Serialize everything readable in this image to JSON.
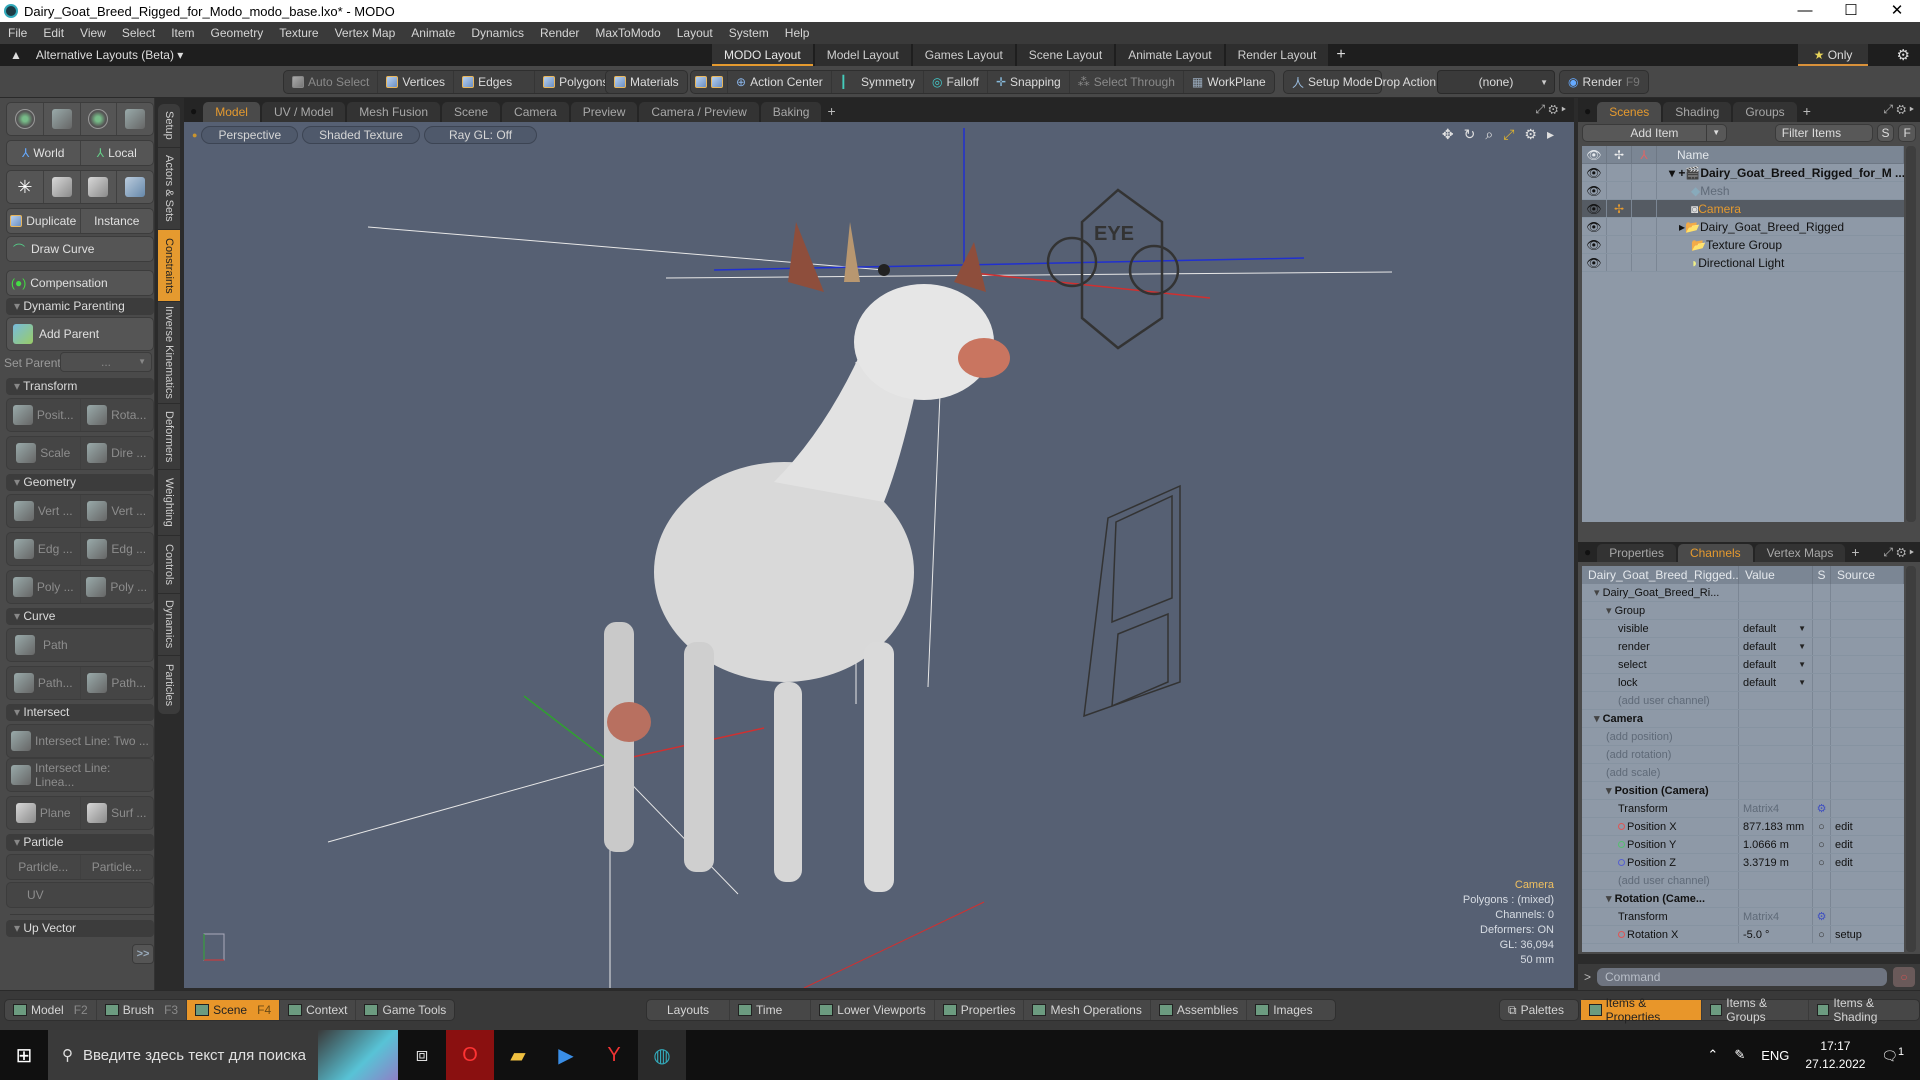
{
  "window": {
    "title": "Dairy_Goat_Breed_Rigged_for_Modo_modo_base.lxo* - MODO",
    "controls": [
      "—",
      "☐",
      "✕"
    ]
  },
  "menu": [
    "File",
    "Edit",
    "View",
    "Select",
    "Item",
    "Geometry",
    "Texture",
    "Vertex Map",
    "Animate",
    "Dynamics",
    "Render",
    "MaxToModo",
    "Layout",
    "System",
    "Help"
  ],
  "layout_row": {
    "alternative_layouts": "Alternative Layouts (Beta) ▾",
    "tabs": [
      "MODO Layout",
      "Model Layout",
      "Games Layout",
      "Scene Layout",
      "Animate Layout",
      "Render Layout"
    ],
    "active_tab": "MODO Layout",
    "plus": "+",
    "only_label": "Only"
  },
  "toolbar": {
    "auto_select": "Auto Select",
    "vertices": "Vertices",
    "edges": "Edges",
    "polygons": "Polygons",
    "materials": "Materials",
    "action_center": "Action Center",
    "symmetry": "Symmetry",
    "falloff": "Falloff",
    "snapping": "Snapping",
    "select_through": "Select Through",
    "workplane": "WorkPlane",
    "setup_mode": "Setup Mode",
    "drop_action": "Drop Action",
    "drop_action_value": "(none)",
    "render": "Render",
    "render_key": "F9"
  },
  "left_panel": {
    "world": "World",
    "local": "Local",
    "duplicate": "Duplicate",
    "instance": "Instance",
    "draw_curve": "Draw Curve",
    "compensation": "Compensation",
    "dynamic_parenting": "Dynamic Parenting",
    "add_parent": "Add Parent",
    "set_parent": "Set Parent",
    "set_parent_value": "...",
    "transform": "Transform",
    "transform_buttons": [
      "Posit...",
      "Rota...",
      "Scale",
      "Dire ..."
    ],
    "geometry": "Geometry",
    "geometry_buttons": [
      "Vert ...",
      "Vert ...",
      "Edg ...",
      "Edg ...",
      "Poly ...",
      "Poly ..."
    ],
    "curve": "Curve",
    "path": "Path",
    "path_buttons": [
      "Path...",
      "Path..."
    ],
    "intersect": "Intersect",
    "intersect_buttons": [
      "Intersect Line: Two ...",
      "Intersect Line: Linea..."
    ],
    "plane_buttons": [
      "Plane",
      "Surf ..."
    ],
    "particle": "Particle",
    "particle_buttons": [
      "Particle...",
      "Particle..."
    ],
    "uv": "UV",
    "up_vector": "Up Vector",
    "more": ">>"
  },
  "vertical_tabs": [
    "Setup",
    "Actors & Sets",
    "Constraints",
    "Inverse Kinematics",
    "Deformers",
    "Weighting",
    "Controls",
    "Dynamics",
    "Particles"
  ],
  "active_vertical_tab": "Constraints",
  "viewport": {
    "tabs": [
      "Model",
      "UV / Model",
      "Mesh Fusion",
      "Scene",
      "Camera",
      "Preview",
      "Camera / Preview",
      "Baking"
    ],
    "active_tab": "Model",
    "view_mode": "Perspective",
    "shading": "Shaded Texture",
    "raygl": "Ray GL: Off",
    "gizmo_label": "EYE",
    "hud": {
      "item": "Camera",
      "polygons": "Polygons : (mixed)",
      "channels": "Channels: 0",
      "deformers": "Deformers: ON",
      "gl": "GL: 36,094",
      "focal": "50 mm"
    }
  },
  "scenes_panel": {
    "tabs": [
      "Scenes",
      "Shading",
      "Groups"
    ],
    "active_tab": "Scenes",
    "add_item": "Add Item",
    "filter_placeholder": "Filter Items",
    "s_btn": "S",
    "f_btn": "F",
    "column_name": "Name",
    "items": [
      {
        "name": "Dairy_Goat_Breed_Rigged_for_M ...",
        "level": 0,
        "type": "scene",
        "selected": false
      },
      {
        "name": "Mesh",
        "level": 1,
        "type": "mesh",
        "selected": false,
        "dim": true
      },
      {
        "name": "Camera",
        "level": 1,
        "type": "camera",
        "selected": true
      },
      {
        "name": "Dairy_Goat_Breed_Rigged",
        "level": 1,
        "type": "group",
        "selected": false
      },
      {
        "name": "Texture Group",
        "level": 1,
        "type": "group",
        "selected": false
      },
      {
        "name": "Directional Light",
        "level": 1,
        "type": "light",
        "selected": false
      }
    ]
  },
  "channels_panel": {
    "tabs": [
      "Properties",
      "Channels",
      "Vertex Maps"
    ],
    "active_tab": "Channels",
    "columns": [
      "Dairy_Goat_Breed_Rigged...",
      "Value",
      "S",
      "Source"
    ],
    "rows": [
      {
        "name": "Dairy_Goat_Breed_Ri...",
        "value": "",
        "s": "",
        "source": "",
        "indent": 1,
        "style": "item"
      },
      {
        "name": "Group",
        "value": "",
        "s": "",
        "source": "",
        "indent": 2,
        "style": "item"
      },
      {
        "name": "visible",
        "value": "default",
        "s": "",
        "source": "",
        "indent": 3,
        "dropdown": true
      },
      {
        "name": "render",
        "value": "default",
        "s": "",
        "source": "",
        "indent": 3,
        "dropdown": true
      },
      {
        "name": "select",
        "value": "default",
        "s": "",
        "source": "",
        "indent": 3,
        "dropdown": true
      },
      {
        "name": "lock",
        "value": "default",
        "s": "",
        "source": "",
        "indent": 3,
        "dropdown": true
      },
      {
        "name": "(add user channel)",
        "value": "",
        "s": "",
        "source": "",
        "indent": 3,
        "style": "ghost"
      },
      {
        "name": "Camera",
        "value": "",
        "s": "",
        "source": "",
        "indent": 1,
        "style": "bold"
      },
      {
        "name": "(add position)",
        "value": "",
        "s": "",
        "source": "",
        "indent": 2,
        "style": "ghost"
      },
      {
        "name": "(add rotation)",
        "value": "",
        "s": "",
        "source": "",
        "indent": 2,
        "style": "ghost"
      },
      {
        "name": "(add scale)",
        "value": "",
        "s": "",
        "source": "",
        "indent": 2,
        "style": "ghost"
      },
      {
        "name": "Position (Camera)",
        "value": "",
        "s": "",
        "source": "",
        "indent": 2,
        "style": "bold"
      },
      {
        "name": "Transform",
        "value": "Matrix4",
        "s": "⚙",
        "source": "",
        "indent": 3,
        "valstyle": "ghost"
      },
      {
        "name": "Position X",
        "value": "877.183 mm",
        "s": "○",
        "source": "edit",
        "indent": 3,
        "dot": "#e05555"
      },
      {
        "name": "Position Y",
        "value": "1.0666 m",
        "s": "○",
        "source": "edit",
        "indent": 3,
        "dot": "#55c070"
      },
      {
        "name": "Position Z",
        "value": "3.3719 m",
        "s": "○",
        "source": "edit",
        "indent": 3,
        "dot": "#5560d0"
      },
      {
        "name": "(add user channel)",
        "value": "",
        "s": "",
        "source": "",
        "indent": 3,
        "style": "ghost"
      },
      {
        "name": "Rotation (Came...",
        "value": "",
        "s": "",
        "source": "",
        "indent": 2,
        "style": "bold"
      },
      {
        "name": "Transform",
        "value": "Matrix4",
        "s": "⚙",
        "source": "",
        "indent": 3,
        "valstyle": "ghost"
      },
      {
        "name": "Rotation X",
        "value": "-5.0 °",
        "s": "○",
        "source": "setup",
        "indent": 3,
        "dot": "#e05555"
      }
    ]
  },
  "command": {
    "prompt": ">",
    "placeholder": "Command"
  },
  "bottom_bar": {
    "left": [
      {
        "label": "Model",
        "key": "F2"
      },
      {
        "label": "Brush",
        "key": "F3"
      },
      {
        "label": "Scene",
        "key": "F4",
        "active": true
      },
      {
        "label": "Context",
        "key": ""
      },
      {
        "label": "Game Tools",
        "key": ""
      }
    ],
    "middle": [
      "Layouts",
      "Time",
      "Lower Viewports",
      "Properties",
      "Mesh Operations",
      "Assemblies",
      "Images"
    ],
    "palettes": "Palettes",
    "right": [
      {
        "label": "Items & Properties",
        "active": true
      },
      {
        "label": "Items & Groups"
      },
      {
        "label": "Items & Shading"
      }
    ]
  },
  "taskbar": {
    "search_placeholder": "Введите здесь текст для поиска",
    "lang": "ENG",
    "time": "17:17",
    "date": "27.12.2022",
    "notifications": "1"
  }
}
